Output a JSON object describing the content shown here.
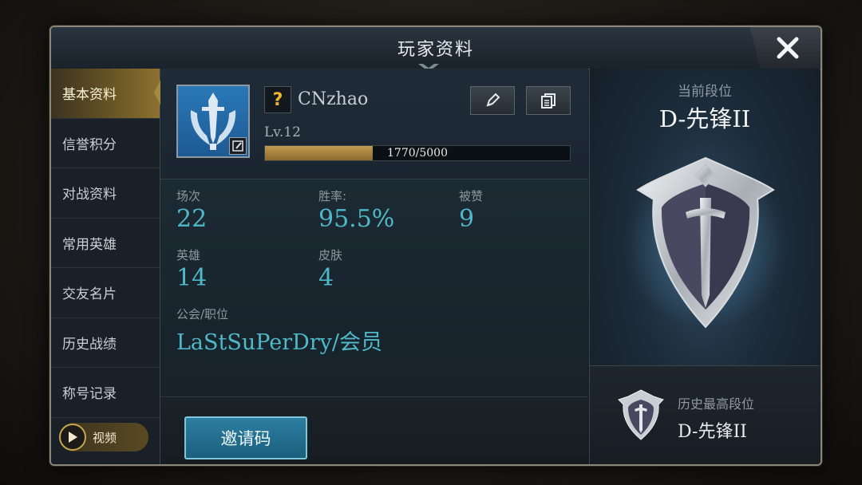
{
  "dialog": {
    "title": "玩家资料"
  },
  "sidebar": {
    "items": [
      {
        "label": "基本资料",
        "active": true
      },
      {
        "label": "信誉积分"
      },
      {
        "label": "对战资料"
      },
      {
        "label": "常用英雄"
      },
      {
        "label": "交友名片"
      },
      {
        "label": "历史战绩"
      },
      {
        "label": "称号记录"
      }
    ],
    "video_label": "视频"
  },
  "profile": {
    "question_mark": "?",
    "name": "CNzhao",
    "level": "Lv.12",
    "xp_text": "1770/5000",
    "xp_current": 1770,
    "xp_max": 5000
  },
  "stats": {
    "matches_label": "场次",
    "matches_value": "22",
    "winrate_label": "胜率:",
    "winrate_value": "95.5%",
    "likes_label": "被赞",
    "likes_value": "9",
    "heroes_label": "英雄",
    "heroes_value": "14",
    "skins_label": "皮肤",
    "skins_value": "4",
    "guild_label": "公会/职位",
    "guild_value": "LaStSuPerDry/会员"
  },
  "invite": {
    "label": "邀请码"
  },
  "rank": {
    "current_label": "当前段位",
    "current_name": "D-先锋II",
    "best_label": "历史最高段位",
    "best_name": "D-先锋II"
  },
  "colors": {
    "accent_teal": "#4fb8c9",
    "active_gold": "#8c7130",
    "xp_fill": "#c29a50",
    "invite_blue": "#2d7ea0"
  },
  "icons": {
    "close": "close-icon",
    "edit": "pencil-icon",
    "copy": "copy-icon",
    "play": "play-icon",
    "avatar": "sword-shield-icon",
    "rank": "rank-shield-icon"
  }
}
